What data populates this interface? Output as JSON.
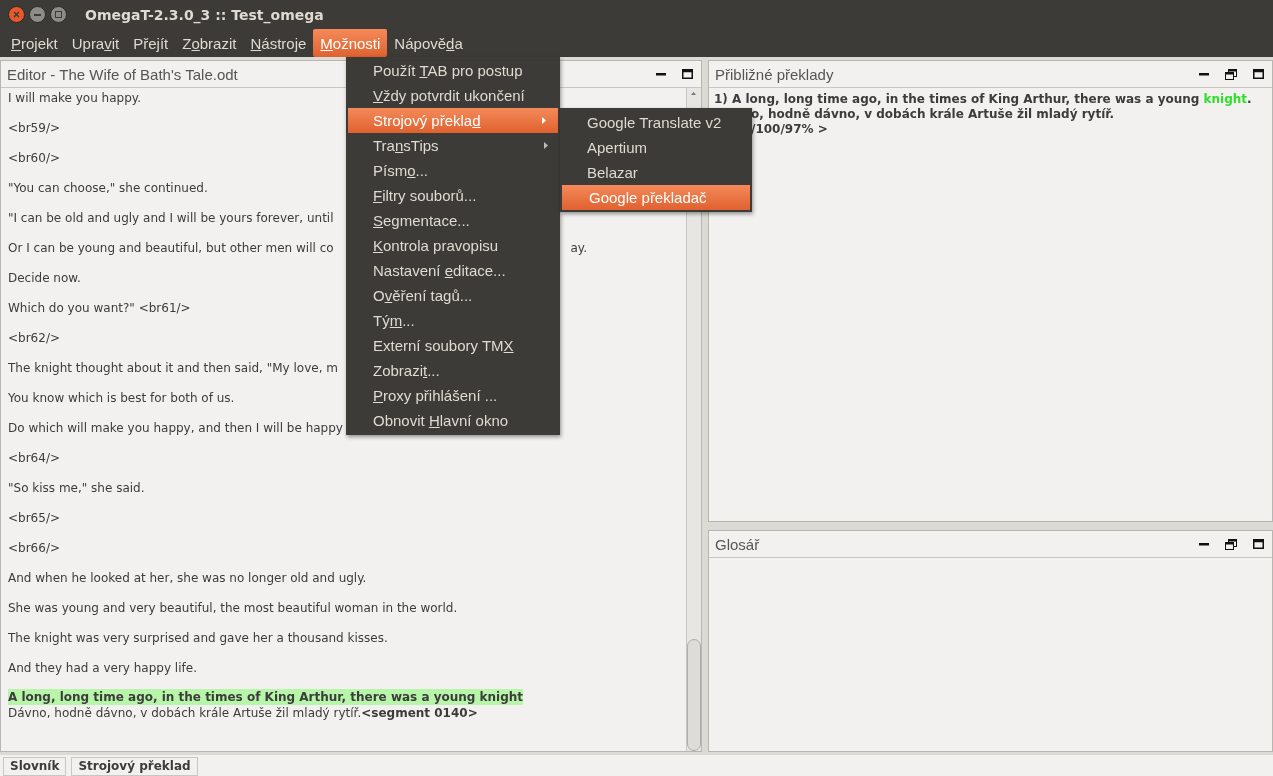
{
  "window": {
    "title": "OmegaT-2.3.0_3 :: Test_omega"
  },
  "menu_bar": [
    {
      "key": "P",
      "post": "rojekt",
      "selected": false
    },
    {
      "pre": "Upra",
      "key": "v",
      "post": "it",
      "selected": false
    },
    {
      "pre": "Pře",
      "key": "j",
      "post": "ít",
      "selected": false
    },
    {
      "pre": "Z",
      "key": "o",
      "post": "brazit",
      "selected": false
    },
    {
      "key": "N",
      "post": "ástroje",
      "selected": false
    },
    {
      "key": "M",
      "post": "ožnosti",
      "selected": true
    },
    {
      "pre": "Nápově",
      "key": "d",
      "post": "a",
      "selected": false
    }
  ],
  "open_menu": {
    "items": [
      {
        "pre": "Použít ",
        "key": "T",
        "post": "AB pro postup",
        "kind": "action",
        "selected": false
      },
      {
        "key": "V",
        "post": "ždy potvrdit ukončení",
        "kind": "action",
        "selected": false
      },
      {
        "pre": "Strojový překla",
        "key": "d",
        "kind": "submenu",
        "selected": true
      },
      {
        "pre": "Tra",
        "key": "n",
        "post": "sTips",
        "kind": "submenu",
        "selected": false
      },
      {
        "pre": "Písm",
        "key": "o",
        "post": "...",
        "kind": "action",
        "selected": false
      },
      {
        "key": "F",
        "post": "iltry souborů...",
        "kind": "action",
        "selected": false
      },
      {
        "key": "S",
        "post": "egmentace...",
        "kind": "action",
        "selected": false
      },
      {
        "key": "K",
        "post": "ontrola pravopisu",
        "kind": "action",
        "selected": false
      },
      {
        "pre": "Nastavení ",
        "key": "e",
        "post": "ditace...",
        "kind": "action",
        "selected": false
      },
      {
        "pre": "O",
        "key": "v",
        "post": "ěření tagů...",
        "kind": "action",
        "selected": false
      },
      {
        "pre": "Tý",
        "key": "m",
        "post": "...",
        "kind": "action",
        "selected": false
      },
      {
        "pre": "Externí soubory TM",
        "key": "X",
        "kind": "action",
        "selected": false
      },
      {
        "pre": "Zobrazi",
        "key": "t",
        "post": "...",
        "kind": "action",
        "selected": false
      },
      {
        "key": "P",
        "post": "roxy přihlášení ...",
        "kind": "action",
        "selected": false
      },
      {
        "pre": "Obnovit ",
        "key": "H",
        "post": "lavní okno",
        "kind": "action",
        "selected": false
      }
    ],
    "submenu": [
      {
        "label": "Google Translate v2",
        "selected": false
      },
      {
        "label": "Apertium",
        "selected": false
      },
      {
        "label": "Belazar",
        "selected": false
      },
      {
        "label": "Google překladač",
        "selected": true
      }
    ]
  },
  "editor": {
    "title": "Editor - The Wife of Bath's Tale.odt",
    "lines": [
      {
        "text": "I will make you happy."
      },
      {
        "text": "<br59/>"
      },
      {
        "text": "<br60/>"
      },
      {
        "text": "\"You can choose,\" she continued."
      },
      {
        "text": "\"I can be old and ugly and I will be yours forever, until"
      },
      {
        "text": "Or I can be young and beautiful, but other men will co",
        "tail": "ay."
      },
      {
        "text": "Decide now."
      },
      {
        "text": "Which do you want?\" <br61/>"
      },
      {
        "text": "<br62/>"
      },
      {
        "text": "The knight thought about it and then said, \"My love, m"
      },
      {
        "text": "You know which is best for both of us."
      },
      {
        "text": "Do which will make you happy, and then I will be happy"
      },
      {
        "text": "<br64/>"
      },
      {
        "text": "\"So kiss me,\" she said."
      },
      {
        "text": "<br65/>"
      },
      {
        "text": "<br66/>"
      },
      {
        "text": "And when he looked at her, she was no longer old and ugly."
      },
      {
        "text": "She was young and very beautiful, the most beautiful woman in the world."
      },
      {
        "text": "The knight was very surprised and gave her a thousand kisses."
      },
      {
        "text": "And they had a very happy life."
      }
    ],
    "active_segment": {
      "source": "A long, long time ago, in the times of King Arthur, there was a young knight",
      "target": "Dávno, hodně dávno, v dobách krále Artuše žil mladý rytíř.",
      "marker": "<segment 0140>"
    }
  },
  "fuzzy_matches": {
    "title": "Přibližné překlady",
    "match": {
      "prefix": "1) A long, long time ago, in the times of King Arthur, there was a young ",
      "highlight": "knight",
      "suffix": "."
    },
    "lines": [
      "o, hodně dávno, v dobách krále Artuše žil mladý rytíř.",
      "/100/97%  >"
    ]
  },
  "glossary": {
    "title": "Glosář"
  },
  "bottom_tabs": [
    "Slovník",
    "Strojový překlad"
  ]
}
